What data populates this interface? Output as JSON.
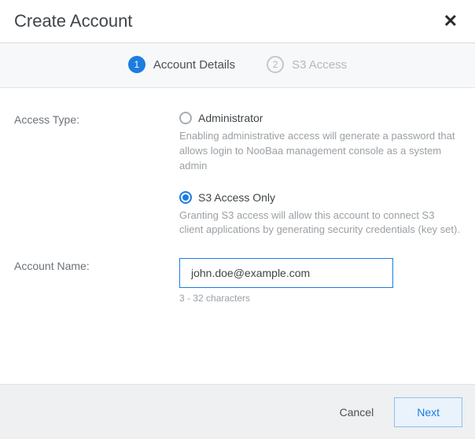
{
  "header": {
    "title": "Create Account"
  },
  "stepper": {
    "step1": {
      "num": "1",
      "label": "Account Details"
    },
    "step2": {
      "num": "2",
      "label": "S3 Access"
    }
  },
  "form": {
    "accessType": {
      "label": "Access Type:",
      "administrator": {
        "label": "Administrator",
        "desc": "Enabling administrative access will generate a password that allows login to NooBaa management console as a system admin"
      },
      "s3only": {
        "label": "S3 Access Only",
        "desc": "Granting S3 access will allow this account to connect S3 client applications by generating security credentials (key set)."
      }
    },
    "accountName": {
      "label": "Account Name:",
      "value": "john.doe@example.com",
      "hint": "3 - 32 characters"
    }
  },
  "footer": {
    "cancel": "Cancel",
    "next": "Next"
  }
}
